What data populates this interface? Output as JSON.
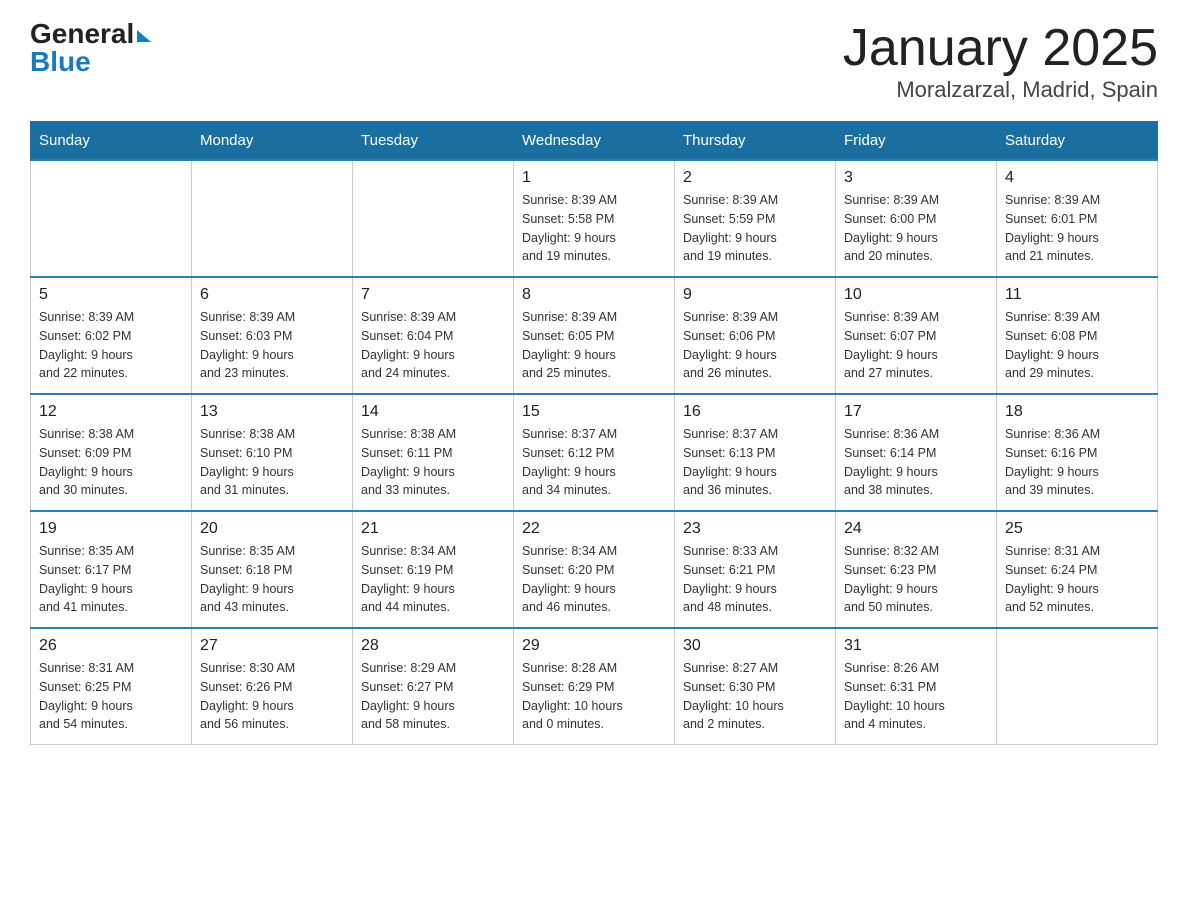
{
  "logo": {
    "general": "General",
    "blue": "Blue"
  },
  "title": "January 2025",
  "subtitle": "Moralzarzal, Madrid, Spain",
  "days_of_week": [
    "Sunday",
    "Monday",
    "Tuesday",
    "Wednesday",
    "Thursday",
    "Friday",
    "Saturday"
  ],
  "weeks": [
    [
      {
        "day": "",
        "info": ""
      },
      {
        "day": "",
        "info": ""
      },
      {
        "day": "",
        "info": ""
      },
      {
        "day": "1",
        "info": "Sunrise: 8:39 AM\nSunset: 5:58 PM\nDaylight: 9 hours\nand 19 minutes."
      },
      {
        "day": "2",
        "info": "Sunrise: 8:39 AM\nSunset: 5:59 PM\nDaylight: 9 hours\nand 19 minutes."
      },
      {
        "day": "3",
        "info": "Sunrise: 8:39 AM\nSunset: 6:00 PM\nDaylight: 9 hours\nand 20 minutes."
      },
      {
        "day": "4",
        "info": "Sunrise: 8:39 AM\nSunset: 6:01 PM\nDaylight: 9 hours\nand 21 minutes."
      }
    ],
    [
      {
        "day": "5",
        "info": "Sunrise: 8:39 AM\nSunset: 6:02 PM\nDaylight: 9 hours\nand 22 minutes."
      },
      {
        "day": "6",
        "info": "Sunrise: 8:39 AM\nSunset: 6:03 PM\nDaylight: 9 hours\nand 23 minutes."
      },
      {
        "day": "7",
        "info": "Sunrise: 8:39 AM\nSunset: 6:04 PM\nDaylight: 9 hours\nand 24 minutes."
      },
      {
        "day": "8",
        "info": "Sunrise: 8:39 AM\nSunset: 6:05 PM\nDaylight: 9 hours\nand 25 minutes."
      },
      {
        "day": "9",
        "info": "Sunrise: 8:39 AM\nSunset: 6:06 PM\nDaylight: 9 hours\nand 26 minutes."
      },
      {
        "day": "10",
        "info": "Sunrise: 8:39 AM\nSunset: 6:07 PM\nDaylight: 9 hours\nand 27 minutes."
      },
      {
        "day": "11",
        "info": "Sunrise: 8:39 AM\nSunset: 6:08 PM\nDaylight: 9 hours\nand 29 minutes."
      }
    ],
    [
      {
        "day": "12",
        "info": "Sunrise: 8:38 AM\nSunset: 6:09 PM\nDaylight: 9 hours\nand 30 minutes."
      },
      {
        "day": "13",
        "info": "Sunrise: 8:38 AM\nSunset: 6:10 PM\nDaylight: 9 hours\nand 31 minutes."
      },
      {
        "day": "14",
        "info": "Sunrise: 8:38 AM\nSunset: 6:11 PM\nDaylight: 9 hours\nand 33 minutes."
      },
      {
        "day": "15",
        "info": "Sunrise: 8:37 AM\nSunset: 6:12 PM\nDaylight: 9 hours\nand 34 minutes."
      },
      {
        "day": "16",
        "info": "Sunrise: 8:37 AM\nSunset: 6:13 PM\nDaylight: 9 hours\nand 36 minutes."
      },
      {
        "day": "17",
        "info": "Sunrise: 8:36 AM\nSunset: 6:14 PM\nDaylight: 9 hours\nand 38 minutes."
      },
      {
        "day": "18",
        "info": "Sunrise: 8:36 AM\nSunset: 6:16 PM\nDaylight: 9 hours\nand 39 minutes."
      }
    ],
    [
      {
        "day": "19",
        "info": "Sunrise: 8:35 AM\nSunset: 6:17 PM\nDaylight: 9 hours\nand 41 minutes."
      },
      {
        "day": "20",
        "info": "Sunrise: 8:35 AM\nSunset: 6:18 PM\nDaylight: 9 hours\nand 43 minutes."
      },
      {
        "day": "21",
        "info": "Sunrise: 8:34 AM\nSunset: 6:19 PM\nDaylight: 9 hours\nand 44 minutes."
      },
      {
        "day": "22",
        "info": "Sunrise: 8:34 AM\nSunset: 6:20 PM\nDaylight: 9 hours\nand 46 minutes."
      },
      {
        "day": "23",
        "info": "Sunrise: 8:33 AM\nSunset: 6:21 PM\nDaylight: 9 hours\nand 48 minutes."
      },
      {
        "day": "24",
        "info": "Sunrise: 8:32 AM\nSunset: 6:23 PM\nDaylight: 9 hours\nand 50 minutes."
      },
      {
        "day": "25",
        "info": "Sunrise: 8:31 AM\nSunset: 6:24 PM\nDaylight: 9 hours\nand 52 minutes."
      }
    ],
    [
      {
        "day": "26",
        "info": "Sunrise: 8:31 AM\nSunset: 6:25 PM\nDaylight: 9 hours\nand 54 minutes."
      },
      {
        "day": "27",
        "info": "Sunrise: 8:30 AM\nSunset: 6:26 PM\nDaylight: 9 hours\nand 56 minutes."
      },
      {
        "day": "28",
        "info": "Sunrise: 8:29 AM\nSunset: 6:27 PM\nDaylight: 9 hours\nand 58 minutes."
      },
      {
        "day": "29",
        "info": "Sunrise: 8:28 AM\nSunset: 6:29 PM\nDaylight: 10 hours\nand 0 minutes."
      },
      {
        "day": "30",
        "info": "Sunrise: 8:27 AM\nSunset: 6:30 PM\nDaylight: 10 hours\nand 2 minutes."
      },
      {
        "day": "31",
        "info": "Sunrise: 8:26 AM\nSunset: 6:31 PM\nDaylight: 10 hours\nand 4 minutes."
      },
      {
        "day": "",
        "info": ""
      }
    ]
  ]
}
